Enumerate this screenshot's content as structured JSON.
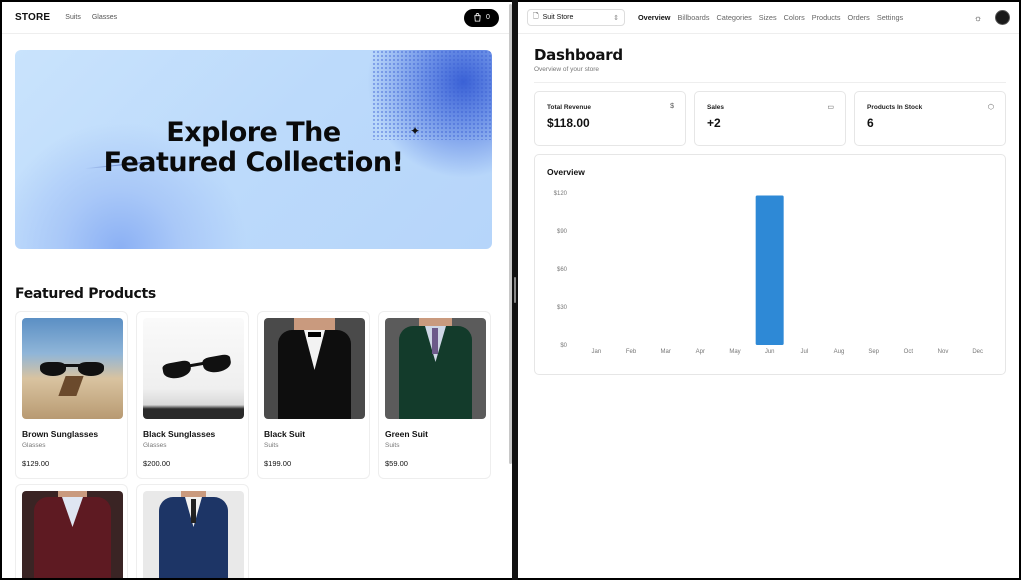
{
  "store": {
    "brand": "STORE",
    "nav": [
      "Suits",
      "Glasses"
    ],
    "cart_count": "0",
    "hero_line1": "Explore The",
    "hero_line2": "Featured Collection!",
    "featured_title": "Featured Products",
    "products": [
      {
        "name": "Brown Sunglasses",
        "category": "Glasses",
        "price": "$129.00"
      },
      {
        "name": "Black Sunglasses",
        "category": "Glasses",
        "price": "$200.00"
      },
      {
        "name": "Black Suit",
        "category": "Suits",
        "price": "$199.00"
      },
      {
        "name": "Green Suit",
        "category": "Suits",
        "price": "$59.00"
      }
    ]
  },
  "admin": {
    "store_switcher": "Suit Store",
    "nav": [
      "Overview",
      "Billboards",
      "Categories",
      "Sizes",
      "Colors",
      "Products",
      "Orders",
      "Settings"
    ],
    "active_nav": "Overview",
    "title": "Dashboard",
    "subtitle": "Overview of your store",
    "stats": [
      {
        "label": "Total Revenue",
        "value": "$118.00",
        "icon": "dollar-icon"
      },
      {
        "label": "Sales",
        "value": "+2",
        "icon": "credit-card-icon"
      },
      {
        "label": "Products In Stock",
        "value": "6",
        "icon": "package-icon"
      }
    ],
    "overview_title": "Overview"
  },
  "chart_data": {
    "type": "bar",
    "categories": [
      "Jan",
      "Feb",
      "Mar",
      "Apr",
      "May",
      "Jun",
      "Jul",
      "Aug",
      "Sep",
      "Oct",
      "Nov",
      "Dec"
    ],
    "values": [
      0,
      0,
      0,
      0,
      0,
      118,
      0,
      0,
      0,
      0,
      0,
      0
    ],
    "yticks": [
      "$0",
      "$30",
      "$60",
      "$90",
      "$120"
    ],
    "ylim": [
      0,
      120
    ],
    "bar_color": "#2e89d6",
    "grid": false
  }
}
